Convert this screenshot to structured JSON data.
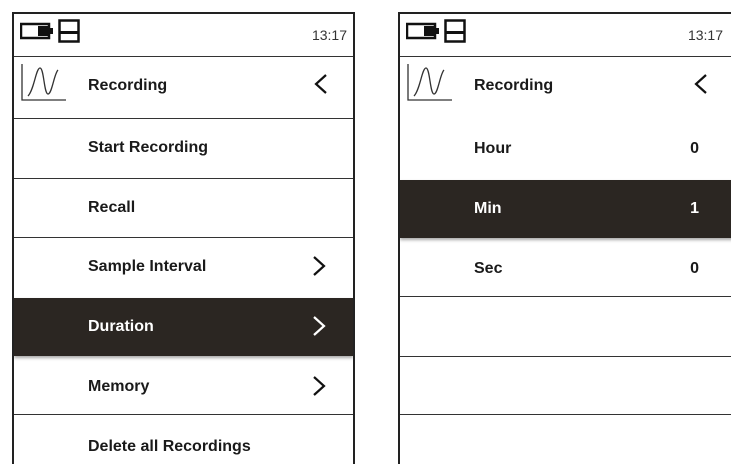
{
  "left": {
    "status": {
      "time": "13:17"
    },
    "title": "Recording",
    "items": [
      {
        "label": "Start Recording",
        "chevron": false,
        "selected": false
      },
      {
        "label": "Recall",
        "chevron": false,
        "selected": false
      },
      {
        "label": "Sample Interval",
        "chevron": true,
        "selected": false
      },
      {
        "label": "Duration",
        "chevron": true,
        "selected": true
      },
      {
        "label": "Memory",
        "chevron": true,
        "selected": false
      },
      {
        "label": "Delete all Recordings",
        "chevron": false,
        "selected": false
      }
    ]
  },
  "right": {
    "status": {
      "time": "13:17"
    },
    "title": "Recording",
    "items": [
      {
        "label": "Hour",
        "value": "0",
        "selected": false
      },
      {
        "label": "Min",
        "value": "1",
        "selected": true
      },
      {
        "label": "Sec",
        "value": "0",
        "selected": false
      }
    ]
  },
  "colors": {
    "selected_bg": "#2b2622",
    "text": "#1a1a1a",
    "border": "#222222"
  },
  "icons": {
    "battery": "battery-icon",
    "save": "save-icon",
    "wave": "waveform-icon",
    "back": "chevron-left-icon",
    "forward": "chevron-right-icon"
  }
}
